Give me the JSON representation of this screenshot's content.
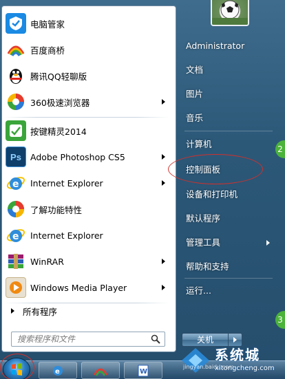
{
  "left_pane": {
    "items": [
      {
        "label": "电脑管家",
        "icon": "tencent-pc-manager-icon",
        "has_arrow": false
      },
      {
        "label": "百度商桥",
        "icon": "baidu-shangqiao-icon",
        "has_arrow": false
      },
      {
        "label": "腾讯QQ轻聊版",
        "icon": "qq-penguin-icon",
        "has_arrow": false
      },
      {
        "label": "360极速浏览器",
        "icon": "360-browser-icon",
        "has_arrow": true
      },
      {
        "label": "按键精灵2014",
        "icon": "anjian-jingling-icon",
        "has_arrow": false
      },
      {
        "label": "Adobe Photoshop CS5",
        "icon": "photoshop-icon",
        "has_arrow": true
      },
      {
        "label": "Internet Explorer",
        "icon": "internet-explorer-icon",
        "has_arrow": true
      },
      {
        "label": "了解功能特性",
        "icon": "windows-features-icon",
        "has_arrow": false
      },
      {
        "label": "Internet Explorer",
        "icon": "internet-explorer-icon",
        "has_arrow": false
      },
      {
        "label": "WinRAR",
        "icon": "winrar-icon",
        "has_arrow": true
      },
      {
        "label": "Windows Media Player",
        "icon": "media-player-icon",
        "has_arrow": true
      }
    ],
    "all_programs": "所有程序",
    "search_placeholder": "搜索程序和文件"
  },
  "right_pane": {
    "items": [
      {
        "label": "Administrator",
        "has_arrow": false
      },
      {
        "label": "文档",
        "has_arrow": false
      },
      {
        "label": "图片",
        "has_arrow": false
      },
      {
        "label": "音乐",
        "has_arrow": false
      },
      {
        "label": "计算机",
        "has_arrow": false
      },
      {
        "label": "控制面板",
        "has_arrow": false
      },
      {
        "label": "设备和打印机",
        "has_arrow": false
      },
      {
        "label": "默认程序",
        "has_arrow": false
      },
      {
        "label": "管理工具",
        "has_arrow": true
      },
      {
        "label": "帮助和支持",
        "has_arrow": false
      },
      {
        "label": "运行...",
        "has_arrow": false
      }
    ],
    "shutdown_label": "关机",
    "edge_badges": [
      "2",
      "3"
    ]
  },
  "watermark": {
    "title": "系统城",
    "subtitle": "xitongcheng.com",
    "url_line": "jingyan.baidu.com"
  },
  "colors": {
    "highlight_circle": "#d2302b",
    "menu_blue": "#2c5878"
  }
}
